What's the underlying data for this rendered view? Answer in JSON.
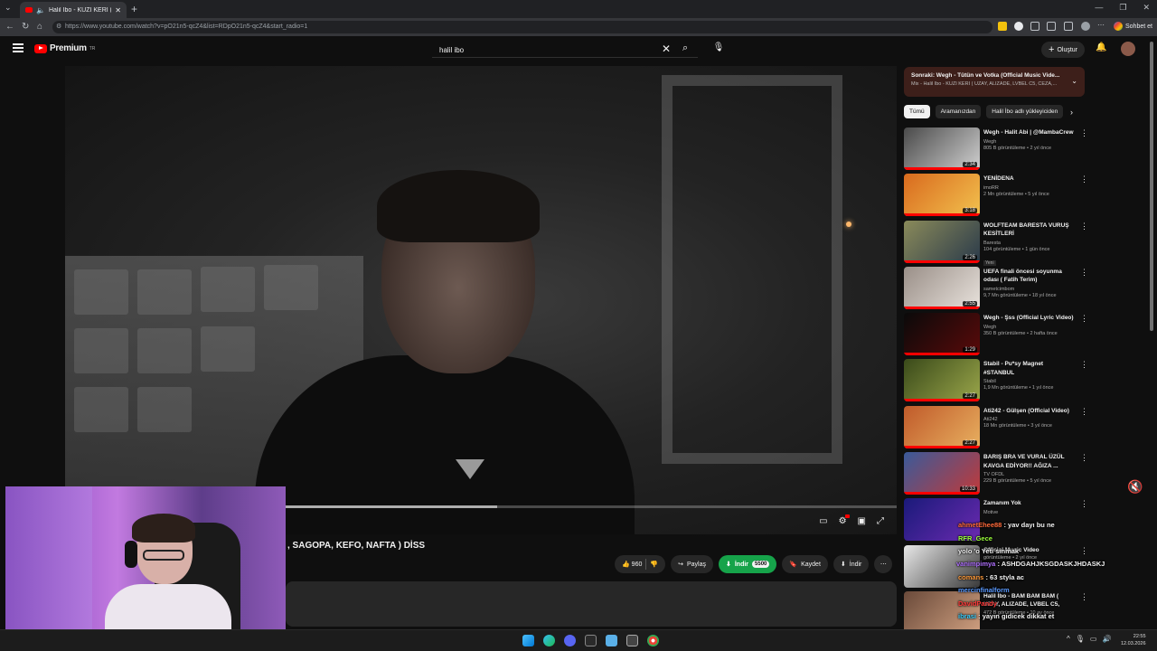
{
  "browser": {
    "tab_title": "Halil İbo - KUZİ KERİ ( UZAY,",
    "url": "https://www.youtube.com/watch?v=pO21n5-qcZ4&list=RDpO21n5-qcZ4&start_radio=1",
    "chat_button": "Sohbet et"
  },
  "header": {
    "logo_text": "Premium",
    "logo_region": "TR",
    "search_value": "halil ibo",
    "create_label": "Oluştur"
  },
  "player": {
    "progress": 0.35
  },
  "video": {
    "title_visible": ", SAGOPA, KEFO, NAFTA ) DİSS",
    "like_count": "960",
    "share_label": "Paylaş",
    "download_label": "İndir",
    "download_price": "5500",
    "save_label": "Kaydet",
    "download2_label": "İndir"
  },
  "up_next": {
    "title": "Sonraki: Wegh - Tütün ve Votka (Official Music Vide...",
    "subtitle": "Mix - Halil İbo - KUZİ KERİ ( UZAY, ALIZADE, LVBEL C5, CEZA,..."
  },
  "chips": [
    "Tümü",
    "Aramanızdan",
    "Halil İbo adlı yükleyiciden"
  ],
  "recommendations": [
    {
      "title": "Wegh - Halit Abi | @MambaCrew",
      "channel": "Wegh",
      "meta": "805 B görüntüleme • 2 yıl önce",
      "duration": "2:34",
      "thumb_color": "#4a4a4a",
      "thumb_color2": "#cfcfcf"
    },
    {
      "title": "YENİDENA",
      "channel": "imoRR",
      "meta": "2 Mn görüntüleme • 5 yıl önce",
      "duration": "3:18",
      "thumb_color": "#d96a1e",
      "thumb_color2": "#f2c14e"
    },
    {
      "title": "WOLFTEAM BARESTA VURUŞ KESİTLERİ",
      "channel": "Baresta",
      "meta": "104 görüntüleme • 1 gün önce",
      "duration": "2:26",
      "thumb_color": "#8a8a5a",
      "thumb_color2": "#2a3a4a",
      "badge": "Yeni"
    },
    {
      "title": "UEFA finali öncesi soyunma odası ( Fatih Terim)",
      "channel": "sametcimbom",
      "meta": "9,7 Mn görüntüleme • 18 yıl önce",
      "duration": "2:55",
      "thumb_color": "#9a8f88",
      "thumb_color2": "#e8e2dc"
    },
    {
      "title": "Wegh - Şss (Official Lyric Video)",
      "channel": "Wegh",
      "meta": "350 B görüntüleme • 2 hafta önce",
      "duration": "1:29",
      "thumb_color": "#0a0a0a",
      "thumb_color2": "#5a0a0a"
    },
    {
      "title": "Stabil - Pu*sy Magnet #STANBUL",
      "channel": "Stabil",
      "meta": "1,9 Mn görüntüleme • 1 yıl önce",
      "duration": "2:27",
      "thumb_color": "#3a4a1a",
      "thumb_color2": "#9aa64a"
    },
    {
      "title": "Ati242 - Gülşen (Official Video)",
      "channel": "Ati242",
      "meta": "18 Mn görüntüleme • 3 yıl önce",
      "duration": "2:27",
      "thumb_color": "#c05a2a",
      "thumb_color2": "#e8b060"
    },
    {
      "title": "BARIŞ BRA VE VURAL ÜZÜL KAVGA EDİYOR!! AĞIZA ...",
      "channel": "TV OFDL",
      "meta": "229 B görüntüleme • 5 yıl önce",
      "duration": "10:33",
      "thumb_color": "#3a5a9a",
      "thumb_color2": "#c03a3a"
    },
    {
      "title": "Zamanım Yok",
      "channel": "Motive",
      "meta": "",
      "duration": "",
      "thumb_color": "#1a1a7a",
      "thumb_color2": "#6a2ab0"
    },
    {
      "title": "Official Music Video",
      "channel": "",
      "meta": "görüntüleme • 2 yıl önce",
      "duration": "",
      "thumb_color": "#e8e8e8",
      "thumb_color2": "#3a3a3a"
    },
    {
      "title": "Halil İbo - BAM BAM BAM ( UZAY, ALIZADE, LVBEL C5, KEF...",
      "channel": "",
      "meta": "472 B görüntüleme • 10 ay önce",
      "duration": "",
      "thumb_color": "#6a4a3a",
      "thumb_color2": "#d0a080"
    }
  ],
  "chat": [
    {
      "user": "ahmetEhee88",
      "text": "yav dayı bu ne",
      "color": "#ff6a3a"
    },
    {
      "user": "RFR_Gece",
      "text": "",
      "color": "#9aff3a"
    },
    {
      "user": "",
      "text": "yolo 'o Yeti sinmak",
      "color": "#ffffff"
    },
    {
      "user": "vanimpimya",
      "text": "ASHDGAHJKSGDASKJHDASKJ",
      "color": "#b070ff"
    },
    {
      "user": "comans",
      "text": "63 styla ac",
      "color": "#ff9a3a"
    },
    {
      "user": "mercinfinalform",
      "text": "",
      "color": "#5a9aff"
    },
    {
      "user": "DavidPandy",
      "text": "",
      "color": "#ff3a3a"
    },
    {
      "user": "ibrasi",
      "text": "yayın gidicek dikkat et",
      "color": "#3ad0ff"
    },
    {
      "user": "",
      "text": "",
      "color": "#ff5a5a"
    },
    {
      "user": "SupremeSky",
      "text": "lazım adama",
      "color": "#3aff9a"
    }
  ],
  "taskbar": {
    "time": "22:55",
    "date": "12.03.2026"
  },
  "colors": {
    "accent": "#ff0000",
    "download_green": "#16a34a",
    "up_next_bg": "#3d1f1a"
  }
}
